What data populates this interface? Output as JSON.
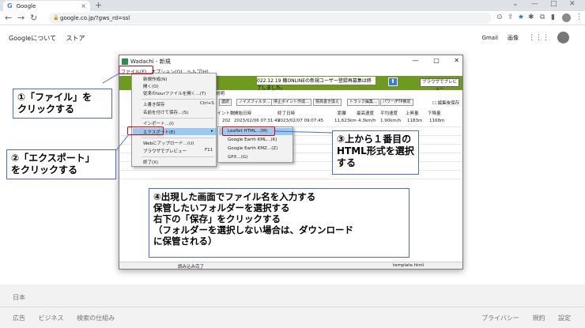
{
  "browser": {
    "tab_title": "Google",
    "tab_close": "×",
    "new_tab": "+",
    "url": "google.co.jp/?gws_rd=ssl",
    "win_minimize": "⌄",
    "win_min": "—",
    "win_max": "□",
    "win_close": "✕"
  },
  "google": {
    "left_links": [
      "Googleについて",
      "ストア"
    ],
    "right_links": [
      "Gmail",
      "画像"
    ],
    "footer_country": "日本",
    "footer_left": [
      "広告",
      "ビジネス",
      "検索の仕組み"
    ],
    "footer_right": [
      "プライバシー",
      "規約",
      "設定"
    ]
  },
  "app": {
    "title": "Wadachi - 新規",
    "window_buttons": [
      "—",
      "□",
      "✕"
    ],
    "menu": [
      "ファイル(F)",
      "オプション(O)",
      "ヘルプ(H)"
    ],
    "notice": "022.12.19 轍ONLINEの新規ユーザー登録再募集は終了しました。",
    "arrow_button": "⬆",
    "preview_button": "ブラウザでプレビュー",
    "explanation_label": "説明",
    "tool_buttons": [
      "連続",
      "ノイズフィルタ…",
      "停止ポイント作成…",
      "標高書き換え",
      "トラック編集…",
      "パワー/FTP推定"
    ],
    "edit_checkbox": "☐ 編集後保存",
    "table_headers": [
      "ポイント数",
      "開始日時",
      "終了日時",
      "距離",
      "最高速度",
      "平均速度",
      "上昇量",
      "下降量"
    ],
    "table_row": [
      "202",
      "2023/02/06 07:31:49",
      "2023/02/07 09:07:45",
      "11.623km",
      "4.3km/h",
      "1.90km/h",
      "1183m",
      "1168m"
    ],
    "status_left": "読み込み完了",
    "status_right": "template.html"
  },
  "file_menu": {
    "items": [
      {
        "label": "新規作成(N)",
        "shortcut": ""
      },
      {
        "label": "開く(O)",
        "shortcut": ""
      },
      {
        "label": "従来のtourファイルを開く…(T)",
        "shortcut": ""
      },
      {
        "label": "上書き保存",
        "shortcut": "Ctrl+S"
      },
      {
        "label": "名前を付けて保存…(S)",
        "shortcut": ""
      },
      {
        "label": "インポート…(I)",
        "shortcut": ""
      },
      {
        "label": "エクスポート(E)",
        "shortcut": "▸"
      },
      {
        "label": "Webにアップロード…(U)",
        "shortcut": ""
      },
      {
        "label": "ブラウザでプレビュー",
        "shortcut": "F11"
      },
      {
        "label": "終了(X)",
        "shortcut": ""
      }
    ]
  },
  "export_submenu": {
    "items": [
      "Leaflet HTML…(M)",
      "Google Earth KML…(K)",
      "Google Earth KMZ…(Z)",
      "GPX…(G)"
    ]
  },
  "callouts": {
    "c1_line1": "①「ファイル」を",
    "c1_line2": "クリックする",
    "c2_line1": "②「エクスポート」",
    "c2_line2": "をクリックする",
    "c3_line1": "③上から１番目の",
    "c3_line2": "HTML形式を選択",
    "c3_line3": "する",
    "c4_line1": "④出現した画面でファイル名を入力する",
    "c4_line2": "保管したいフォルダーを選択する",
    "c4_line3": "右下の「保存」をクリックする",
    "c4_line4": "（フォルダーを選択しない場合は、ダウンロード",
    "c4_line5": "に保管される）"
  },
  "colors": {
    "highlight_red": "#e00000",
    "callout_border": "#4472c4",
    "menu_highlight": "#99c9f0",
    "app_green": "#6e9a1f"
  }
}
